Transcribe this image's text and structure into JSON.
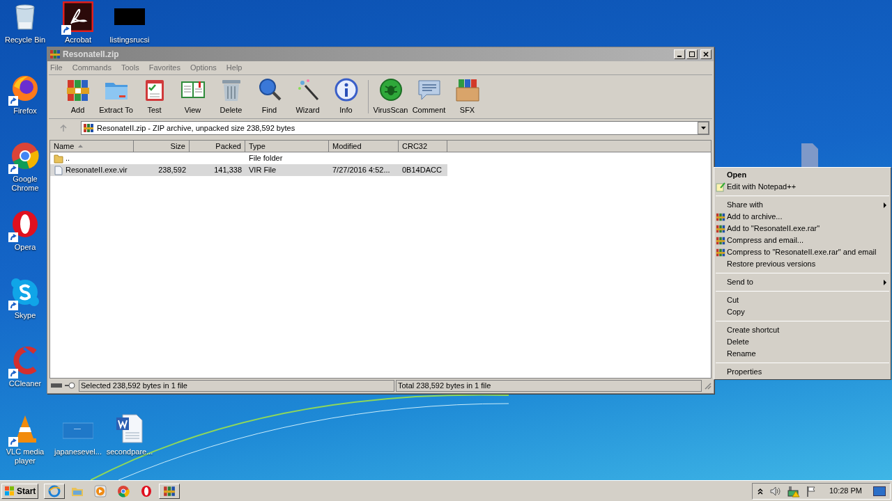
{
  "desktop_icons": [
    {
      "label": "Recycle Bin",
      "kind": "recycle",
      "shortcut": false
    },
    {
      "label": "Acrobat",
      "kind": "acrobat",
      "shortcut": true
    },
    {
      "label": "listingsrucsi",
      "kind": "dark",
      "shortcut": false
    },
    {
      "label": "Firefox",
      "kind": "firefox",
      "shortcut": true
    },
    {
      "label": "Google Chrome",
      "kind": "chrome",
      "shortcut": true
    },
    {
      "label": "Opera",
      "kind": "opera",
      "shortcut": true
    },
    {
      "label": "Skype",
      "kind": "skype",
      "shortcut": true
    },
    {
      "label": "CCleaner",
      "kind": "ccleaner",
      "shortcut": true
    },
    {
      "label": "VLC media player",
      "kind": "vlc",
      "shortcut": true
    },
    {
      "label": "japanesevel...",
      "kind": "blank",
      "shortcut": false
    },
    {
      "label": "secondpare...",
      "kind": "word",
      "shortcut": false
    },
    {
      "kind": "file",
      "shortcut": false
    }
  ],
  "window": {
    "title": "ResonateII.zip",
    "menu": [
      "File",
      "Commands",
      "Tools",
      "Favorites",
      "Options",
      "Help"
    ],
    "toolbar": [
      {
        "label": "Add",
        "kind": "add"
      },
      {
        "label": "Extract To",
        "kind": "extract"
      },
      {
        "label": "Test",
        "kind": "test"
      },
      {
        "label": "View",
        "kind": "view"
      },
      {
        "label": "Delete",
        "kind": "delete"
      },
      {
        "label": "Find",
        "kind": "find"
      },
      {
        "label": "Wizard",
        "kind": "wizard"
      },
      {
        "label": "Info",
        "kind": "info"
      },
      {
        "kind": "separator"
      },
      {
        "label": "VirusScan",
        "kind": "virus"
      },
      {
        "label": "Comment",
        "kind": "comment"
      },
      {
        "label": "SFX",
        "kind": "sfx"
      }
    ],
    "address": "ResonateII.zip - ZIP archive, unpacked size 238,592 bytes",
    "columns": [
      {
        "label": "Name",
        "sorted": true
      },
      {
        "label": "Size",
        "sorted": false
      },
      {
        "label": "Packed",
        "sorted": false
      },
      {
        "label": "Type",
        "sorted": false
      },
      {
        "label": "Modified",
        "sorted": false
      },
      {
        "label": "CRC32",
        "sorted": false
      }
    ],
    "rows": [
      {
        "kind": "folder",
        "name": "..",
        "size": "",
        "packed": "",
        "type": "File folder",
        "modified": "",
        "crc": "",
        "selected": false
      },
      {
        "kind": "file",
        "name": "ResonateII.exe.vir",
        "size": "238,592",
        "packed": "141,338",
        "type": "VIR File",
        "modified": "7/27/2016 4:52...",
        "crc": "0B14DACC",
        "selected": true
      }
    ],
    "status": {
      "left": "Selected 238,592 bytes in 1 file",
      "right": "Total 238,592 bytes in 1 file"
    }
  },
  "context_menu": [
    {
      "kind": "plain",
      "label": "Open",
      "default": true,
      "submenu": false
    },
    {
      "kind": "notepad",
      "label": "Edit with Notepad++",
      "default": false,
      "submenu": false
    },
    {
      "kind": "separator"
    },
    {
      "kind": "plain",
      "label": "Share with",
      "default": false,
      "submenu": true
    },
    {
      "kind": "winrar",
      "label": "Add to archive...",
      "default": false,
      "submenu": false
    },
    {
      "kind": "winrar",
      "label": "Add to \"ResonateII.exe.rar\"",
      "default": false,
      "submenu": false
    },
    {
      "kind": "winrar",
      "label": "Compress and email...",
      "default": false,
      "submenu": false
    },
    {
      "kind": "winrar",
      "label": "Compress to \"ResonateII.exe.rar\" and email",
      "default": false,
      "submenu": false
    },
    {
      "kind": "plain",
      "label": "Restore previous versions",
      "default": false,
      "submenu": false
    },
    {
      "kind": "separator"
    },
    {
      "kind": "plain",
      "label": "Send to",
      "default": false,
      "submenu": true
    },
    {
      "kind": "separator"
    },
    {
      "kind": "plain",
      "label": "Cut",
      "default": false,
      "submenu": false
    },
    {
      "kind": "plain",
      "label": "Copy",
      "default": false,
      "submenu": false
    },
    {
      "kind": "separator"
    },
    {
      "kind": "plain",
      "label": "Create shortcut",
      "default": false,
      "submenu": false
    },
    {
      "kind": "plain",
      "label": "Delete",
      "default": false,
      "submenu": false
    },
    {
      "kind": "plain",
      "label": "Rename",
      "default": false,
      "submenu": false
    },
    {
      "kind": "separator"
    },
    {
      "kind": "plain",
      "label": "Properties",
      "default": false,
      "submenu": false
    }
  ],
  "taskbar": {
    "start": "Start",
    "clock": "10:28 PM"
  }
}
